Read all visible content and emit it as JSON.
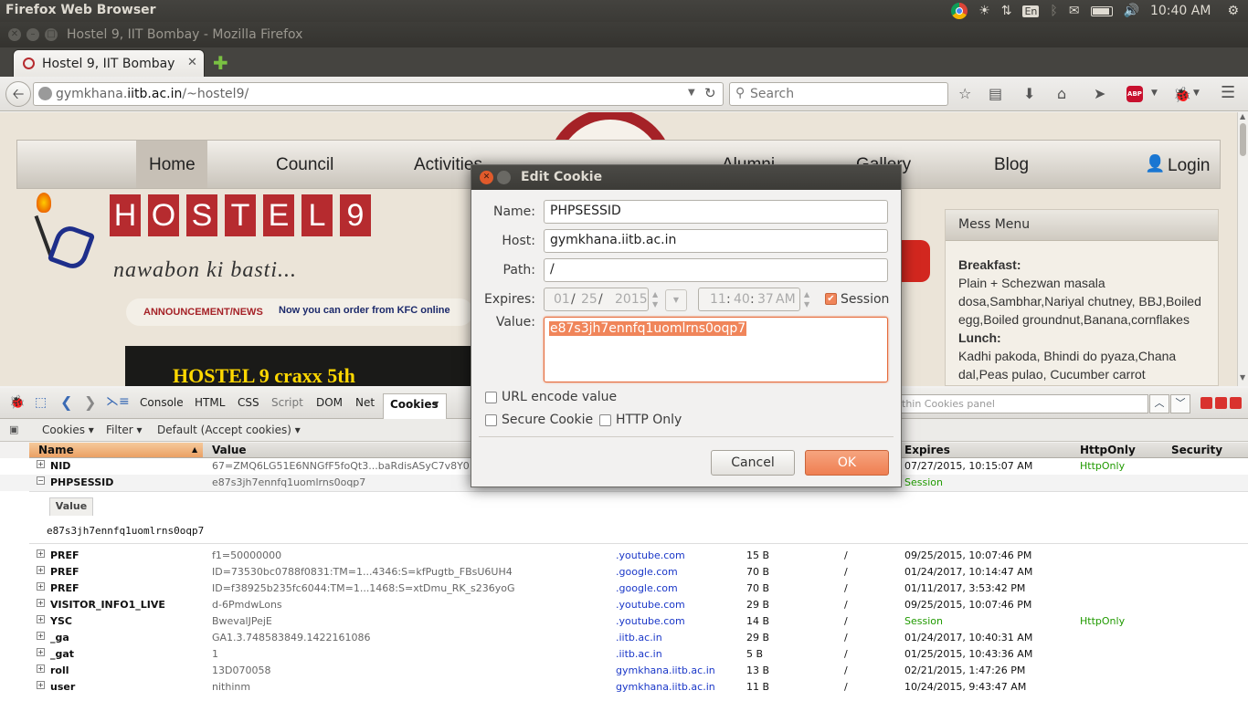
{
  "system": {
    "app_title": "Firefox Web Browser",
    "keyboard": "En",
    "clock": "10:40 AM"
  },
  "window": {
    "title": "Hostel 9, IIT Bombay - Mozilla Firefox",
    "tab_title": "Hostel 9, IIT Bombay"
  },
  "navbar": {
    "url_prefix": "gymkhana.",
    "url_host": "iitb.ac.in",
    "url_path": "/~hostel9/",
    "search_placeholder": "Search",
    "abp_badge": "ABP"
  },
  "site": {
    "menu": [
      "Home",
      "Council",
      "Activities",
      "Alumni",
      "Gallery",
      "Blog",
      "Login"
    ],
    "logo_letters": [
      "H",
      "O",
      "S",
      "T",
      "E",
      "L",
      "9"
    ],
    "tagline": "nawabon ki basti...",
    "announce_label": "ANNOUNCEMENT/NEWS",
    "announce_text": "Now you can order from KFC online",
    "banner_text": "HOSTEL 9 craxx 5th",
    "mess": {
      "title": "Mess Menu",
      "breakfast_label": "Breakfast:",
      "breakfast": "Plain + Schezwan masala dosa,Sambhar,Nariyal chutney, BBJ,Boiled egg,Boiled groundnut,Banana,cornflakes",
      "lunch_label": "Lunch:",
      "lunch": "Kadhi pakoda, Bhindi do pyaza,Chana dal,Peas pulao, Cucumber carrot"
    }
  },
  "firebug": {
    "panels": [
      "Console",
      "HTML",
      "CSS",
      "Script",
      "DOM",
      "Net",
      "Cookies"
    ],
    "active_panel": "Cookies",
    "search_placeholder": "thin Cookies panel",
    "sub_toolbar": [
      "Cookies",
      "Filter",
      "Default (Accept cookies)"
    ],
    "columns": {
      "name": "Name",
      "value": "Value",
      "expires": "Expires",
      "httponly": "HttpOnly",
      "security": "Security"
    },
    "value_tab": "Value",
    "value_content": "e87s3jh7ennfq1uomlrns0oqp7",
    "top_rows": [
      {
        "name": "NID",
        "value": "67=ZMQ6LG51E6NNGfF5foQt3...baRdisASyC7v8Y0",
        "expires": "07/27/2015, 10:15:07 AM",
        "httponly": "HttpOnly"
      },
      {
        "name": "PHPSESSID",
        "value": "e87s3jh7ennfq1uomlrns0oqp7",
        "expires": "Session",
        "httponly": ""
      }
    ],
    "rows": [
      {
        "name": "PREF",
        "value": "f1=50000000",
        "domain": ".youtube.com",
        "size": "15 B",
        "path": "/",
        "expires": "09/25/2015, 10:07:46 PM",
        "httponly": ""
      },
      {
        "name": "PREF",
        "value": "ID=73530bc0788f0831:TM=1...4346:S=kfPugtb_FBsU6UH4",
        "domain": ".google.com",
        "size": "70 B",
        "path": "/",
        "expires": "01/24/2017, 10:14:47 AM",
        "httponly": ""
      },
      {
        "name": "PREF",
        "value": "ID=f38925b235fc6044:TM=1...1468:S=xtDmu_RK_s236yoG",
        "domain": ".google.com",
        "size": "70 B",
        "path": "/",
        "expires": "01/11/2017, 3:53:42 PM",
        "httponly": ""
      },
      {
        "name": "VISITOR_INFO1_LIVE",
        "value": "d-6PmdwLons",
        "domain": ".youtube.com",
        "size": "29 B",
        "path": "/",
        "expires": "09/25/2015, 10:07:46 PM",
        "httponly": ""
      },
      {
        "name": "YSC",
        "value": "BwevalJPejE",
        "domain": ".youtube.com",
        "size": "14 B",
        "path": "/",
        "expires": "Session",
        "httponly": "HttpOnly"
      },
      {
        "name": "_ga",
        "value": "GA1.3.748583849.1422161086",
        "domain": ".iitb.ac.in",
        "size": "29 B",
        "path": "/",
        "expires": "01/24/2017, 10:40:31 AM",
        "httponly": ""
      },
      {
        "name": "_gat",
        "value": "1",
        "domain": ".iitb.ac.in",
        "size": "5 B",
        "path": "/",
        "expires": "01/25/2015, 10:43:36 AM",
        "httponly": ""
      },
      {
        "name": "roll",
        "value": "13D070058",
        "domain": "gymkhana.iitb.ac.in",
        "size": "13 B",
        "path": "/",
        "expires": "02/21/2015, 1:47:26 PM",
        "httponly": ""
      },
      {
        "name": "user",
        "value": "nithinm",
        "domain": "gymkhana.iitb.ac.in",
        "size": "11 B",
        "path": "/",
        "expires": "10/24/2015, 9:43:47 AM",
        "httponly": ""
      }
    ]
  },
  "dialog": {
    "title": "Edit Cookie",
    "name_label": "Name:",
    "name_value": "PHPSESSID",
    "host_label": "Host:",
    "host_value": "gymkhana.iitb.ac.in",
    "path_label": "Path:",
    "path_value": "/",
    "expires_label": "Expires:",
    "date_month": "01",
    "date_day": "25",
    "date_year": "2015",
    "time_hour": "11",
    "time_min": "40",
    "time_sec": "37",
    "time_ampm": "AM",
    "session_label": "Session",
    "value_label": "Value:",
    "value_text": "e87s3jh7ennfq1uomlrns0oqp7",
    "url_encode_label": "URL encode value",
    "secure_label": "Secure Cookie",
    "httponly_label": "HTTP Only",
    "cancel_label": "Cancel",
    "ok_label": "OK",
    "accent": "#f0855a"
  }
}
